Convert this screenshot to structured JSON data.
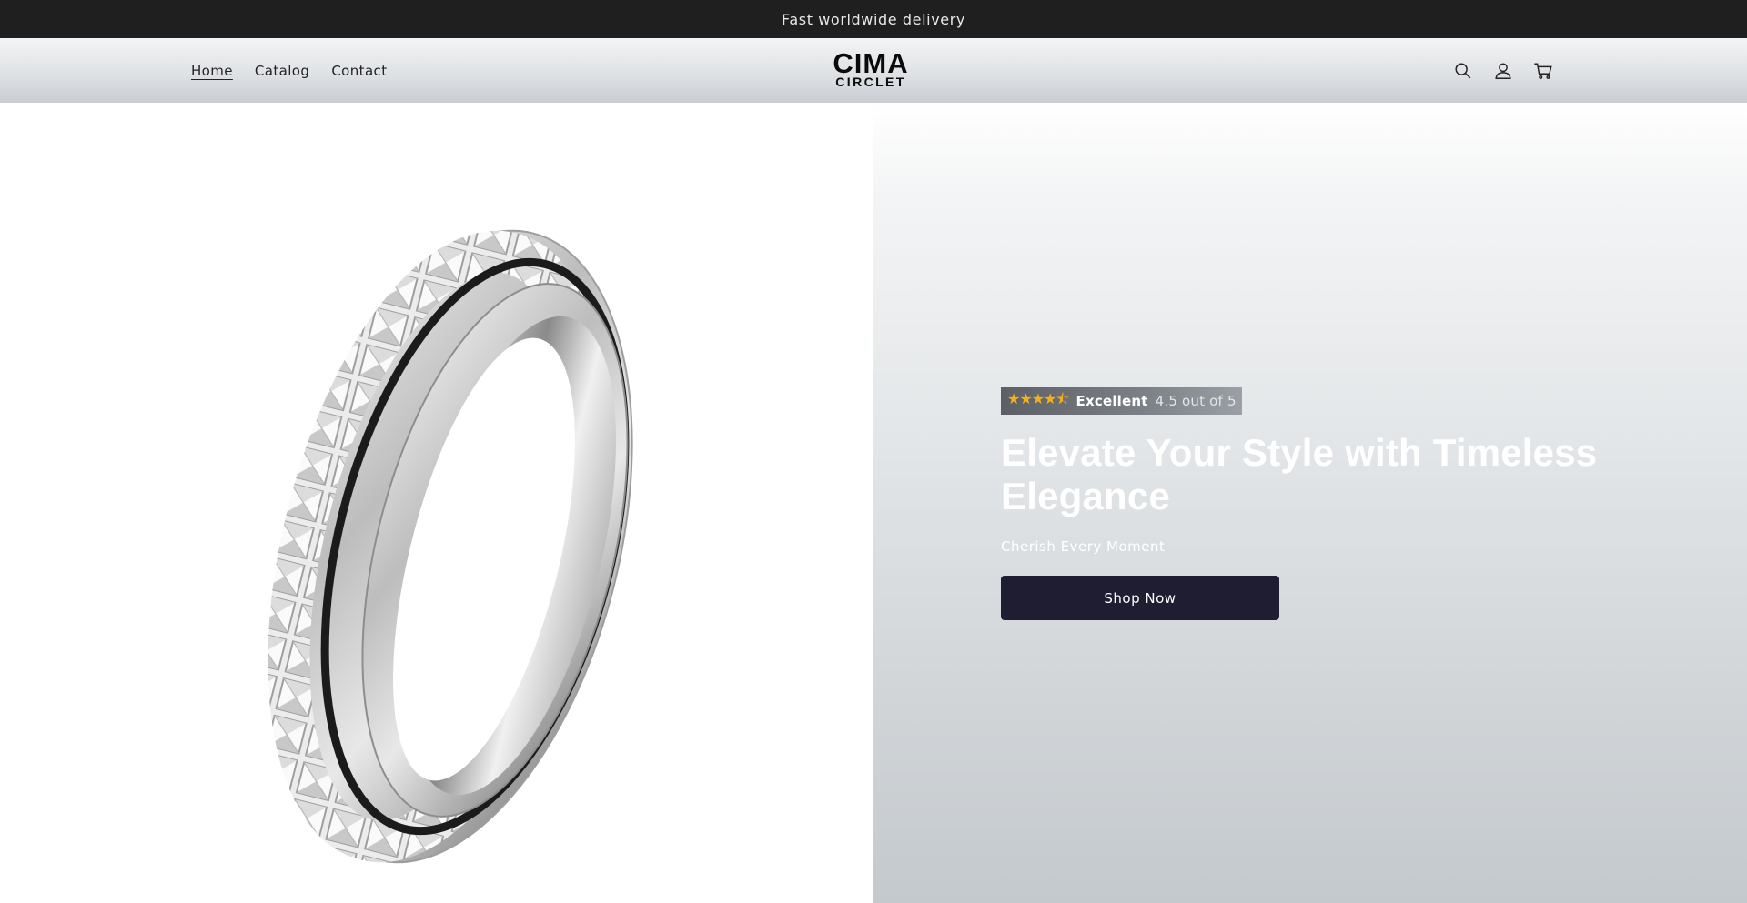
{
  "announcement": {
    "text": "Fast worldwide delivery"
  },
  "nav": {
    "items": [
      {
        "label": "Home",
        "active": true
      },
      {
        "label": "Catalog"
      },
      {
        "label": "Contact"
      }
    ]
  },
  "logo": {
    "line1": "CIMA",
    "line2": "CIRCLET"
  },
  "header_icons": [
    "search-icon",
    "account-icon",
    "cart-icon"
  ],
  "hero": {
    "image": "silver-spinner-ring-with-crystals",
    "rating": {
      "stars": "★★★★⯪",
      "label": "Excellent",
      "text": "4.5 out of 5"
    },
    "headline": "Elevate Your Style with Timeless Elegance",
    "subheading": "Cherish Every Moment",
    "cta_label": "Shop Now"
  },
  "colors": {
    "announcement_bg": "#1f1f1f",
    "cta_bg": "#1f1d31",
    "star": "#f3b01b"
  }
}
